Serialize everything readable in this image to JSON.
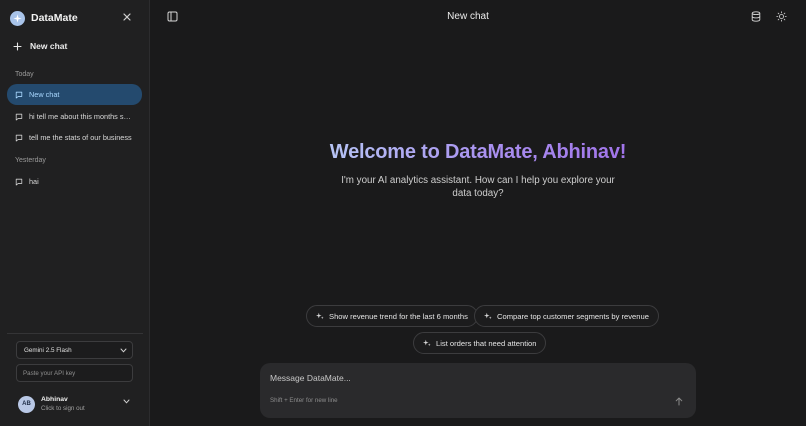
{
  "app": {
    "name": "DataMate"
  },
  "sidebar": {
    "new_chat_label": "New chat",
    "sections": [
      {
        "label": "Today",
        "items": [
          {
            "label": "New chat",
            "active": true
          },
          {
            "label": "hi tell me about this months sal..."
          },
          {
            "label": "tell me the stats of our business"
          }
        ]
      },
      {
        "label": "Yesterday",
        "items": [
          {
            "label": "hai"
          }
        ]
      }
    ],
    "model_select": {
      "value": "Gemini 2.5 Flash"
    },
    "api_key": {
      "placeholder": "Paste your API key"
    },
    "user": {
      "initials": "AB",
      "name": "Abhinav",
      "subtitle": "Click to sign out"
    }
  },
  "header": {
    "title": "New chat"
  },
  "welcome": {
    "heading": "Welcome to DataMate, Abhinav!",
    "subtitle": "I'm your AI analytics assistant. How can I help you explore your data today?"
  },
  "suggestions": [
    {
      "label": "Show revenue trend for the last 6 months"
    },
    {
      "label": "Compare top customer segments by revenue"
    },
    {
      "label": "List orders that need attention"
    }
  ],
  "composer": {
    "placeholder": "Message DataMate...",
    "hint": "Shift + Enter for new line"
  },
  "icons": {
    "logo": "sparkle-icon",
    "close": "close-icon",
    "new_chat": "plus-icon",
    "chat": "chat-bubble-icon",
    "toggle_sidebar": "sidebar-toggle-icon",
    "database": "database-icon",
    "theme": "sun-icon",
    "suggestion": "sparkle-icon",
    "send": "arrow-up-icon",
    "chevron": "chevron-down-icon"
  },
  "colors": {
    "background": "#1a1a1b",
    "sidebar": "#202021",
    "active_item": "#244a6e",
    "active_text": "#a9d8ff",
    "gradient_start": "#b8cdf5",
    "gradient_end": "#9f6ee8"
  }
}
